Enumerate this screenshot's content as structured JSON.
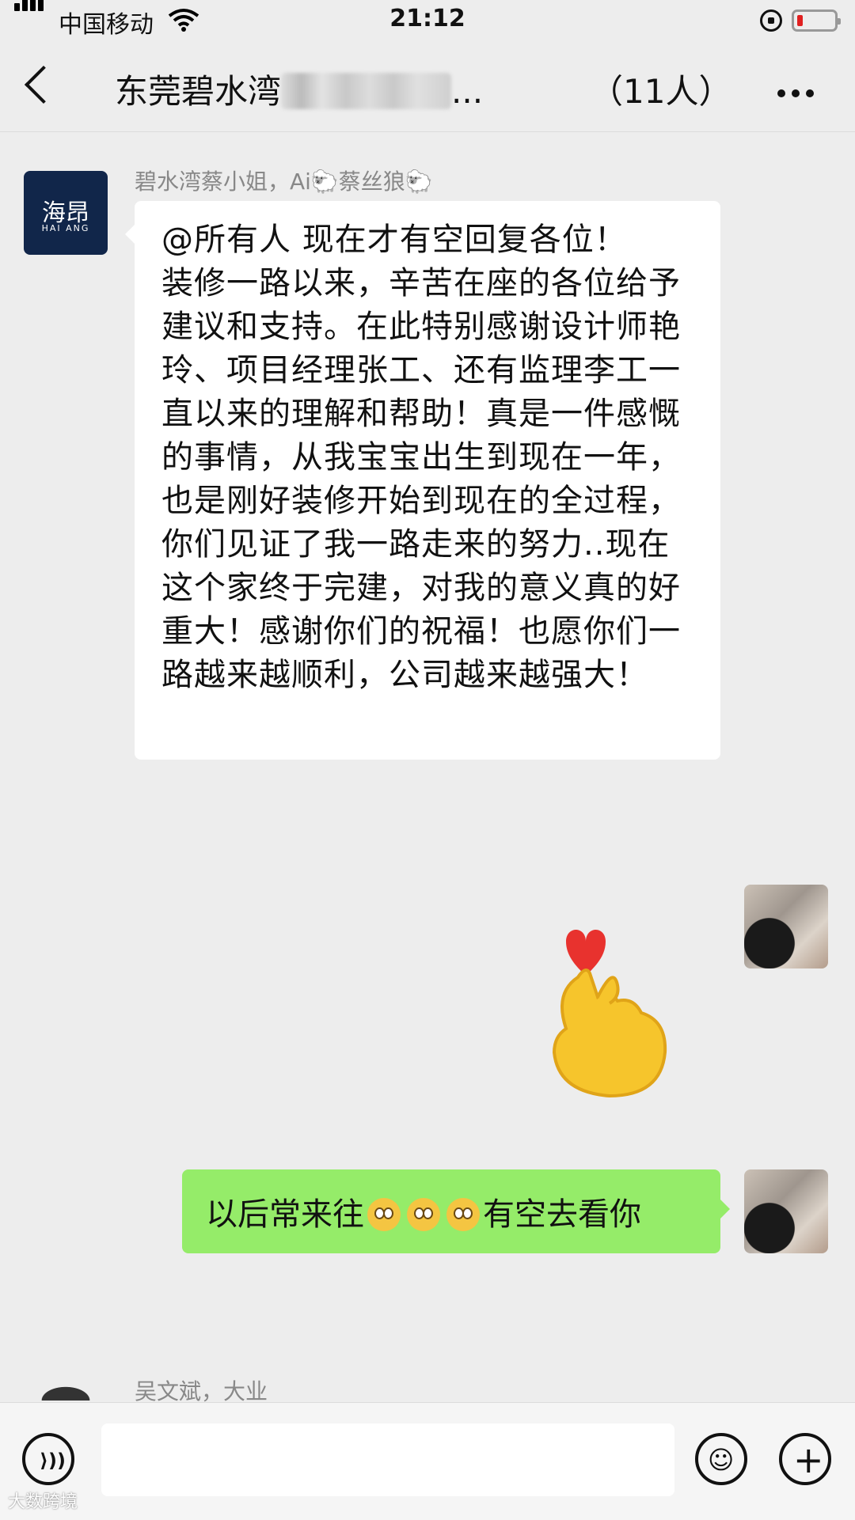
{
  "status_bar": {
    "carrier": "中国移动",
    "time": "21:12"
  },
  "header": {
    "title": "东莞碧水湾",
    "title_suffix": "...",
    "member_count": "（11人）"
  },
  "messages": [
    {
      "sender": "碧水湾蔡小姐，Ai🐑蔡丝狼🐑",
      "avatar_text": "海昂",
      "avatar_sub": "HAI ANG",
      "text": "@所有人 现在才有空回复各位！\n装修一路以来，辛苦在座的各位给予建议和支持。在此特别感谢设计师艳玲、项目经理张工、还有监理李工一直以来的理解和帮助！真是一件感慨的事情，从我宝宝出生到现在一年，也是刚好装修开始到现在的全过程，你们见证了我一路走来的努力..现在这个家终于完建，对我的意义真的好重大！感谢你们的祝福！也愿你们一路越来越顺利，公司越来越强大！"
    },
    {
      "sticker": "finger-heart-sticker"
    },
    {
      "text_before": "以后常来往",
      "text_after": "有空去看你"
    },
    {
      "sender": "吴文斌，大业"
    }
  ],
  "input_bar": {
    "placeholder": ""
  },
  "watermark": "大数跨境",
  "colors": {
    "background": "#ededed",
    "outgoing_bubble": "#95ec69",
    "incoming_bubble": "#ffffff"
  }
}
